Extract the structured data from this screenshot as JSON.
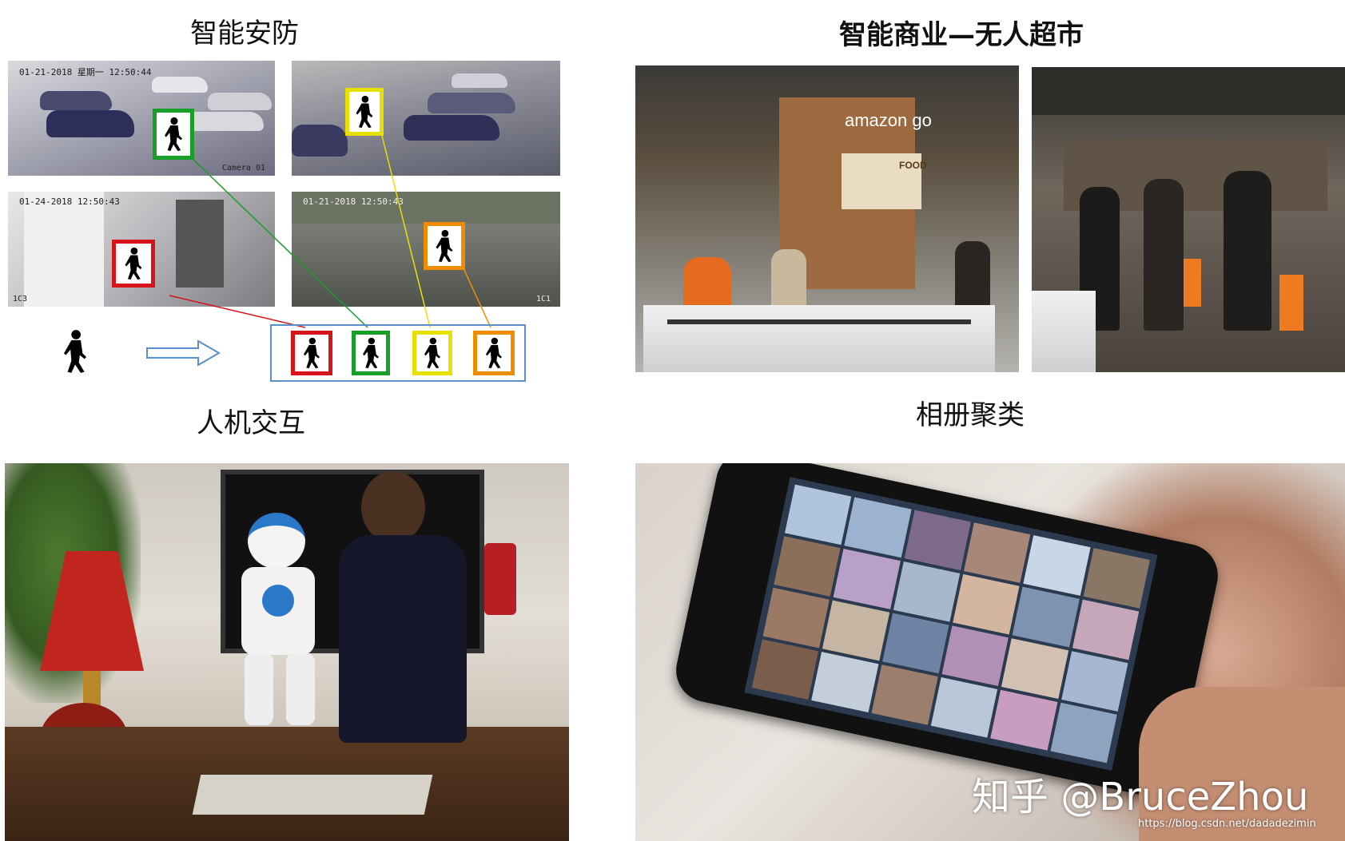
{
  "titles": {
    "security": "智能安防",
    "retail": "智能商业—无人超市",
    "interaction": "人机交互",
    "album": "相册聚类"
  },
  "security_cams": [
    {
      "timestamp": "01-21-2018 星期一 12:50:44",
      "camera_id": "Camera 01"
    },
    {
      "timestamp": "",
      "camera_id": ""
    },
    {
      "timestamp": "01-24-2018 12:50:43",
      "camera_id": "1C3"
    },
    {
      "timestamp": "01-21-2018 12:50:43",
      "camera_id": "1C1"
    }
  ],
  "colors": {
    "green": "#1a9e2a",
    "yellow": "#e8e000",
    "red": "#d7141a",
    "orange": "#f08c00",
    "match_frame": "#5b8fc9"
  },
  "store": {
    "brand": "amazon go",
    "sign_food": "FOOD"
  },
  "watermark": {
    "main": "知乎 @BruceZhou",
    "url": "https://blog.csdn.net/dadadezimin"
  },
  "icons": [
    "walking-person-icon",
    "right-arrow-icon"
  ]
}
